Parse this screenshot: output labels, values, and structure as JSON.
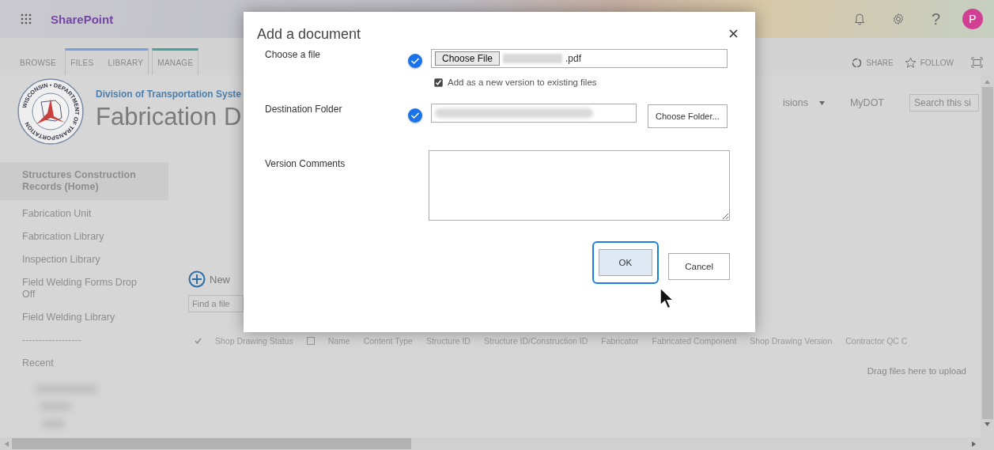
{
  "suite_bar": {
    "app_name": "SharePoint",
    "help": "?",
    "avatar": "P"
  },
  "ribbon": {
    "tab_groups": [
      {
        "tabs": [
          "BROWSE"
        ]
      },
      {
        "color": "#7aa0dc",
        "tabs": [
          "FILES",
          "LIBRARY"
        ]
      },
      {
        "color": "#45a39b",
        "tabs": [
          "MANAGE"
        ]
      }
    ],
    "actions": [
      "SHARE",
      "FOLLOW"
    ]
  },
  "site": {
    "logo_text": "WISCONSIN • DEPARTMENT OF TRANSPORTATION",
    "subtitle": "Division of Transportation Syste",
    "title": "Fabrication D",
    "nav": [
      {
        "label": "isions",
        "dropdown": true
      },
      {
        "label": "MyDOT",
        "dropdown": false
      }
    ],
    "search": {
      "placeholder": "Search this si"
    }
  },
  "sidebar": {
    "items": [
      {
        "label": "Structures Construction Records (Home)",
        "selected": true
      },
      {
        "label": "Fabrication Unit",
        "selected": false
      },
      {
        "label": "Fabrication Library",
        "selected": false
      },
      {
        "label": "Inspection Library",
        "selected": false
      },
      {
        "label": "Field Welding Forms Drop Off",
        "selected": false
      },
      {
        "label": "Field Welding Library",
        "selected": false
      }
    ],
    "separator": "------------------",
    "recent_heading": "Recent"
  },
  "library": {
    "new_button": "New",
    "search": {
      "placeholder": "Find a file"
    },
    "select_all_checked": false,
    "columns": [
      "Shop Drawing Status",
      "Name",
      "Content Type",
      "Structure ID",
      "Structure ID/Construction ID",
      "Fabricator",
      "Fabricated Component",
      "Shop Drawing Version",
      "Contractor QC C"
    ],
    "drop_hint": "Drag files here to upload"
  },
  "dialog": {
    "title": "Add a document",
    "file_row": {
      "label": "Choose a file",
      "valid": true,
      "button": "Choose File",
      "file_suffix": ".pdf"
    },
    "version_checkbox": {
      "label": "Add as a new version to existing files",
      "checked": true
    },
    "folder_row": {
      "label": "Destination Folder",
      "valid": true,
      "button": "Choose Folder..."
    },
    "comments_row": {
      "label": "Version Comments"
    },
    "buttons": [
      {
        "label": "OK",
        "focused": true
      },
      {
        "label": "Cancel",
        "focused": false
      }
    ]
  }
}
